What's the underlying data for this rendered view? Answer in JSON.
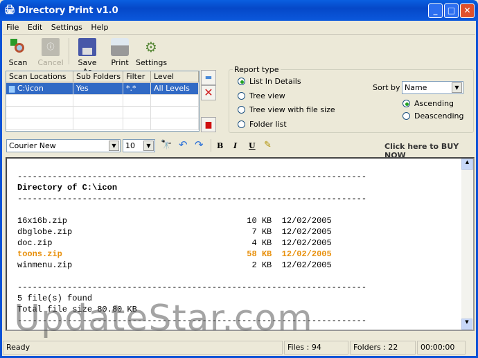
{
  "window": {
    "title": "Directory Print v1.0",
    "min": "_",
    "max": "□",
    "close": "✕"
  },
  "menu": [
    "File",
    "Edit",
    "Settings",
    "Help"
  ],
  "toolbar": {
    "scan": "Scan",
    "cancel": "Cancel",
    "save_as": "Save As",
    "print": "Print",
    "settings": "Settings"
  },
  "grid": {
    "headers": [
      "Scan Locations",
      "Sub Folders",
      "Filter",
      "Level"
    ],
    "rows": [
      [
        "C:\\icon",
        "Yes",
        "*.*",
        "All Levels"
      ]
    ]
  },
  "report": {
    "legend": "Report type",
    "options": [
      "List In Details",
      "Tree view",
      "Tree view with file size",
      "Folder list"
    ],
    "selected": 0,
    "sort_label": "Sort by",
    "sort_value": "Name",
    "order": [
      "Ascending",
      "Deascending"
    ],
    "order_selected": 0
  },
  "format": {
    "font": "Courier New",
    "size": "10",
    "bold": "B",
    "italic": "I",
    "underline": "U",
    "buy": "Click here to BUY NOW"
  },
  "report_text": {
    "rule": "----------------------------------------------------------------------",
    "heading": "Directory of C:\\icon",
    "files": [
      [
        "16x16b.zip",
        "10 KB",
        "12/02/2005"
      ],
      [
        "dbglobe.zip",
        "7 KB",
        "12/02/2005"
      ],
      [
        "doc.zip",
        "4 KB",
        "12/02/2005"
      ],
      [
        "toons.zip",
        "58 KB",
        "12/02/2005"
      ],
      [
        "winmenu.zip",
        "2 KB",
        "12/02/2005"
      ]
    ],
    "highlight_index": 3,
    "found": "5 file(s) found",
    "total": "Total file size 80.80 KB"
  },
  "status": {
    "state": "Ready",
    "files": "Files : 94",
    "folders": "Folders : 22",
    "time": "00:00:00"
  },
  "watermark": "UpdateStar.com"
}
